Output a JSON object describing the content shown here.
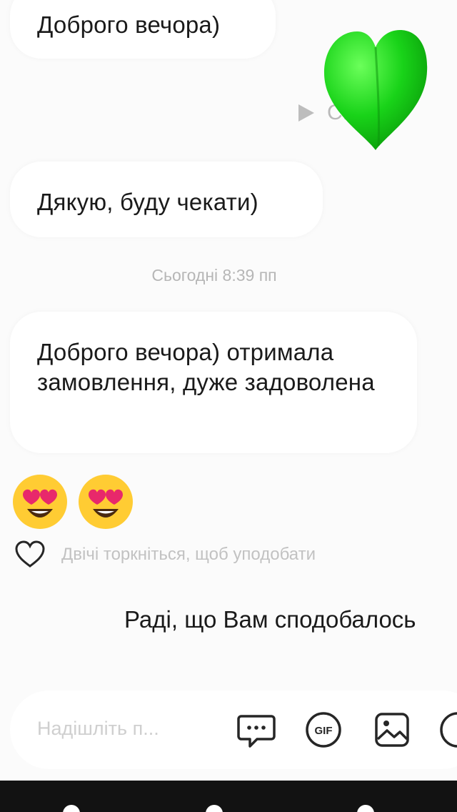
{
  "messages": {
    "incoming_1": "Доброго вечора)",
    "audio_reply_label": "С...на",
    "incoming_2": "Дякую, буду чекати)",
    "timestamp": "Сьогодні 8:39 пп",
    "incoming_3": "Доброго вечора) отримала замовлення, дуже задоволена",
    "emoji_reaction": [
      "smiling-face-with-heart-eyes",
      "smiling-face-with-heart-eyes"
    ],
    "like_hint": "Двічі торкніться, щоб уподобати",
    "outgoing_1": "Раді, що Вам сподобалось"
  },
  "sticker": {
    "name": "green-heart-sticker",
    "color": "#19d319"
  },
  "composer": {
    "placeholder": "Надішліть п...",
    "icons": [
      "chat-bubble-icon",
      "gif-icon",
      "image-icon",
      "sticker-icon"
    ]
  }
}
